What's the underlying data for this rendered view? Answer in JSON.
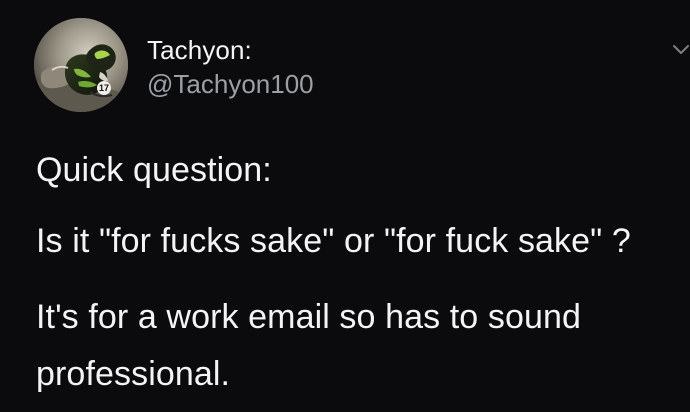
{
  "tweet": {
    "display_name": "Tachyon:",
    "handle": "@Tachyon100",
    "lines": [
      "Quick question:",
      "Is it \"for fucks sake\" or \"for fuck sake\" ?",
      "It's for a work email so has to sound",
      "professional."
    ]
  },
  "icons": {
    "avatar": "profile-photo",
    "menu": "chevron-down-icon"
  },
  "colors": {
    "background": "#0b0a0d",
    "text": "#f4f4f4",
    "secondary_text": "#9aa0a6"
  }
}
